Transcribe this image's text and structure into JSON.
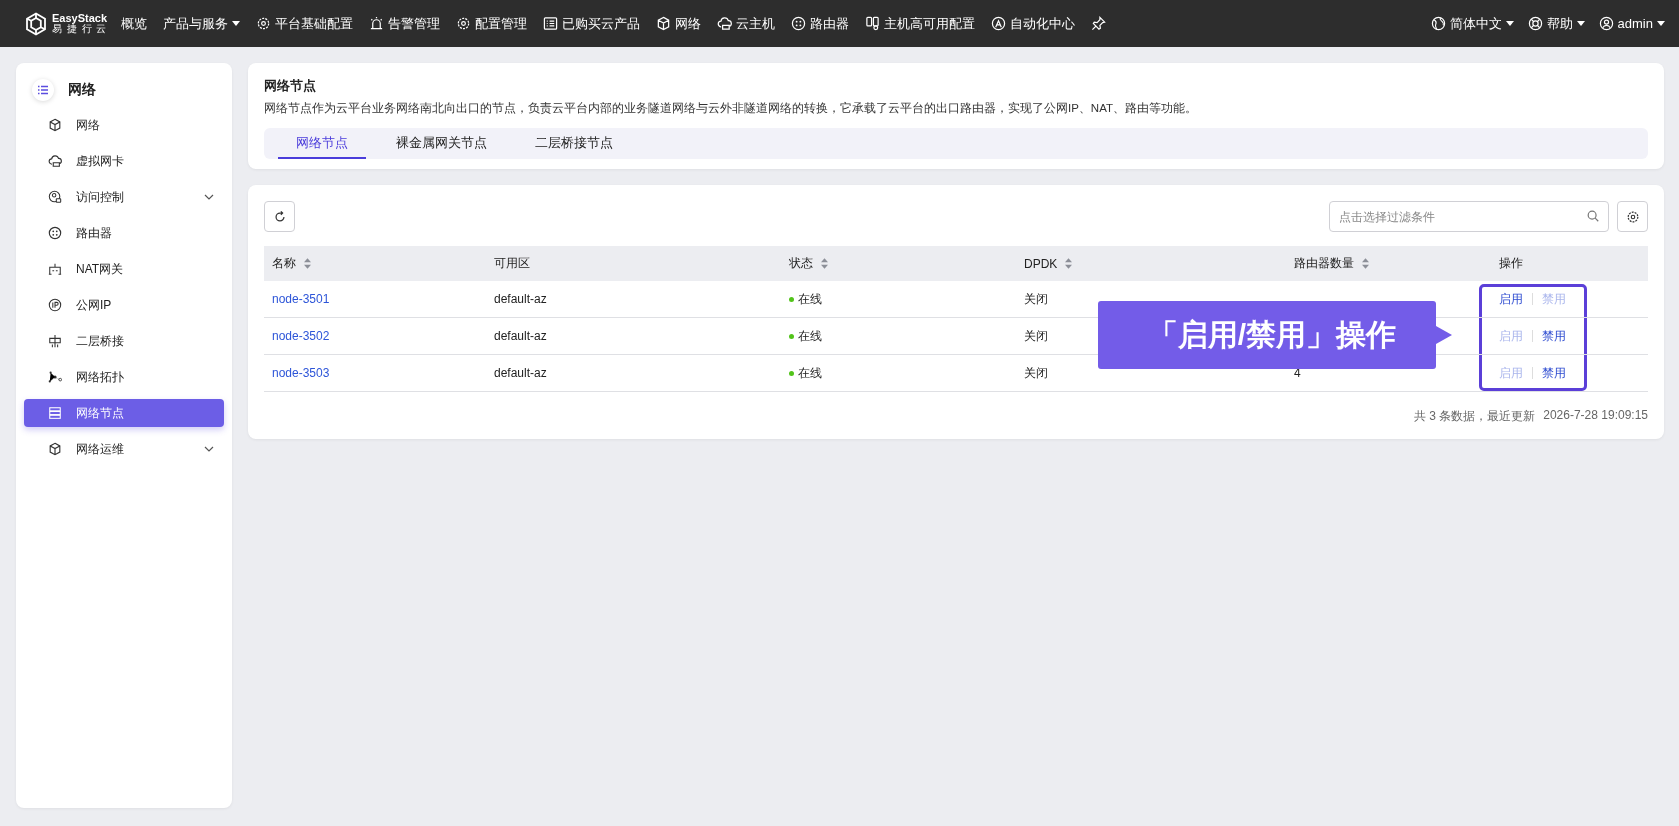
{
  "topbar": {
    "logo": {
      "name": "EasyStack",
      "subtitle": "易 捷 行 云"
    },
    "nav": [
      {
        "label": "概览",
        "dropdown": false
      },
      {
        "label": "产品与服务",
        "dropdown": true
      },
      {
        "label": "平台基础配置",
        "dropdown": false
      },
      {
        "label": "告警管理",
        "dropdown": false
      },
      {
        "label": "配置管理",
        "dropdown": false
      },
      {
        "label": "已购买云产品",
        "dropdown": false
      },
      {
        "label": "网络",
        "dropdown": false
      },
      {
        "label": "云主机",
        "dropdown": false
      },
      {
        "label": "路由器",
        "dropdown": false
      },
      {
        "label": "主机高可用配置",
        "dropdown": false
      },
      {
        "label": "自动化中心",
        "dropdown": false
      }
    ],
    "right": [
      {
        "label": "简体中文"
      },
      {
        "label": "帮助"
      },
      {
        "label": "admin"
      }
    ]
  },
  "sidebar": {
    "title": "网络",
    "items": [
      {
        "label": "网络",
        "selected": false
      },
      {
        "label": "虚拟网卡",
        "selected": false
      },
      {
        "label": "访问控制",
        "selected": false,
        "expanded": false
      },
      {
        "label": "路由器",
        "selected": false
      },
      {
        "label": "NAT网关",
        "selected": false
      },
      {
        "label": "公网IP",
        "selected": false
      },
      {
        "label": "二层桥接",
        "selected": false
      },
      {
        "label": "网络拓扑",
        "selected": false
      },
      {
        "label": "网络节点",
        "selected": true
      },
      {
        "label": "网络运维",
        "selected": false,
        "expanded": false
      }
    ]
  },
  "header": {
    "title": "网络节点",
    "description": "网络节点作为云平台业务网络南北向出口的节点，负责云平台内部的业务隧道网络与云外非隧道网络的转换，它承载了云平台的出口路由器，实现了公网IP、NAT、路由等功能。",
    "tabs": [
      {
        "label": "网络节点",
        "selected": true
      },
      {
        "label": "裸金属网关节点",
        "selected": false
      },
      {
        "label": "二层桥接节点",
        "selected": false
      }
    ]
  },
  "toolbar": {
    "search": {
      "placeholder": "点击选择过滤条件"
    }
  },
  "table": {
    "columns": [
      {
        "label": "名称",
        "sortable": true
      },
      {
        "label": "可用区",
        "sortable": false
      },
      {
        "label": "状态",
        "sortable": true
      },
      {
        "label": "DPDK",
        "sortable": true
      },
      {
        "label": "路由器数量",
        "sortable": true
      },
      {
        "label": "操作",
        "sortable": false
      }
    ],
    "rows": [
      {
        "name": "node-3501",
        "zone": "default-az",
        "status": {
          "label": "在线",
          "color": "#52c41a"
        },
        "dpdk": "关闭",
        "actions": [
          {
            "label": "启用",
            "disabled": false
          },
          {
            "label": "禁用",
            "disabled": true
          }
        ]
      },
      {
        "name": "node-3502",
        "zone": "default-az",
        "status": {
          "label": "在线",
          "color": "#52c41a"
        },
        "dpdk": "关闭",
        "actions": [
          {
            "label": "启用",
            "disabled": true
          },
          {
            "label": "禁用",
            "disabled": false
          }
        ]
      },
      {
        "name": "node-3503",
        "zone": "default-az",
        "status": {
          "label": "在线",
          "color": "#52c41a"
        },
        "dpdk": "关闭",
        "routers": "4",
        "actions": [
          {
            "label": "启用",
            "disabled": true
          },
          {
            "label": "禁用",
            "disabled": false
          }
        ]
      }
    ]
  },
  "footer": {
    "summary": "共 3 条数据，最近更新",
    "updated": "2026-7-28 19:09:15"
  },
  "callout": {
    "text": "「启用/禁用」操作"
  }
}
